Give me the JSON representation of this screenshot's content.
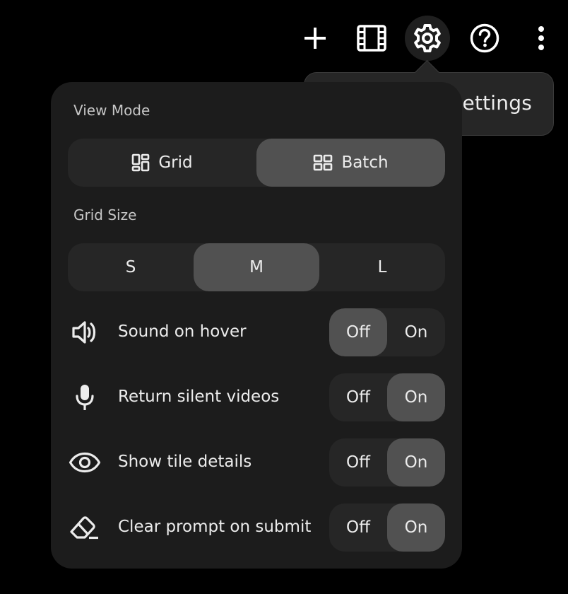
{
  "toolbar": {
    "add_icon": "plus-icon",
    "library_icon": "film-strip-icon",
    "settings_icon": "gear-icon",
    "help_icon": "help-circle-icon",
    "more_icon": "more-vertical-icon"
  },
  "tooltip": {
    "text": "Settings"
  },
  "settings": {
    "view_mode": {
      "label": "View Mode",
      "options": [
        {
          "label": "Grid",
          "icon": "grid-layout-icon",
          "selected": false
        },
        {
          "label": "Batch",
          "icon": "batch-layout-icon",
          "selected": true
        }
      ]
    },
    "grid_size": {
      "label": "Grid Size",
      "options": [
        {
          "label": "S",
          "selected": false
        },
        {
          "label": "M",
          "selected": true
        },
        {
          "label": "L",
          "selected": false
        }
      ]
    },
    "toggles": [
      {
        "label": "Sound on hover",
        "icon": "speaker-icon",
        "off_label": "Off",
        "on_label": "On",
        "value": "Off"
      },
      {
        "label": "Return silent videos",
        "icon": "microphone-icon",
        "off_label": "Off",
        "on_label": "On",
        "value": "On"
      },
      {
        "label": "Show tile details",
        "icon": "eye-icon",
        "off_label": "Off",
        "on_label": "On",
        "value": "On"
      },
      {
        "label": "Clear prompt on submit",
        "icon": "eraser-icon",
        "off_label": "Off",
        "on_label": "On",
        "value": "On"
      }
    ]
  },
  "colors": {
    "background": "#000000",
    "panel": "#1c1c1c",
    "control_track": "#262626",
    "selected": "#515151",
    "text": "#ececec"
  }
}
